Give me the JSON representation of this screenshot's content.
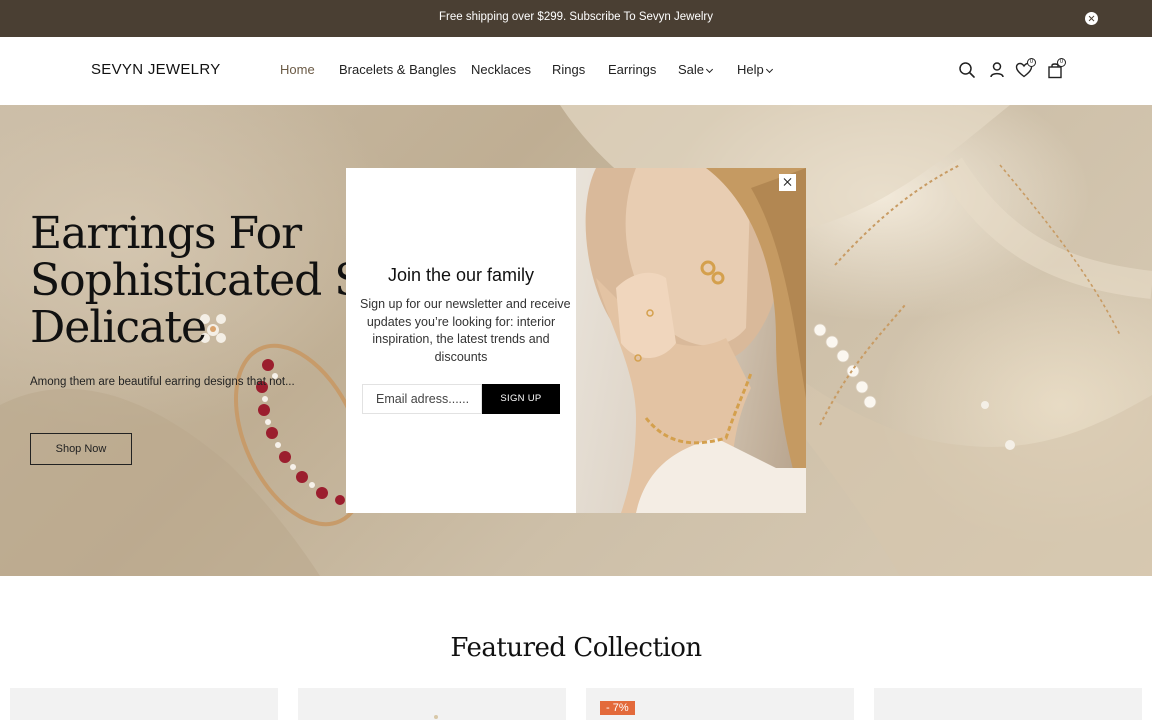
{
  "announcement": {
    "text": "Free shipping over $299. Subscribe To Sevyn Jewelry"
  },
  "header": {
    "logo": "SEVYN JEWELRY",
    "nav": [
      {
        "label": "Home",
        "active": true
      },
      {
        "label": "Bracelets & Bangles"
      },
      {
        "label": "Necklaces"
      },
      {
        "label": "Rings"
      },
      {
        "label": "Earrings"
      },
      {
        "label": "Sale",
        "dropdown": true
      },
      {
        "label": "Help",
        "dropdown": true
      }
    ],
    "icons": [
      "search-icon",
      "user-icon",
      "heart-icon",
      "bag-icon"
    ],
    "wishlist_count": "0",
    "cart_count": "0"
  },
  "hero": {
    "title_lines": [
      "Earrings For",
      "Sophisticated Style",
      "Delicate"
    ],
    "subtitle": "Among them are beautiful earring designs that not...",
    "cta": "Shop Now"
  },
  "popup": {
    "title": "Join the our family",
    "body_lines": [
      "Sign up for our newsletter and receive",
      "updates you’re looking for: interior",
      "inspiration, the latest trends and",
      "discounts"
    ],
    "email_placeholder": "Email adress......",
    "button": "SIGN UP"
  },
  "featured": {
    "title": "Featured Collection",
    "discount_badge": "- 7%"
  },
  "colors": {
    "announcement_bg": "#4a3f33",
    "nav_active": "#6b5a45",
    "discount_badge": "#e36a3b"
  }
}
